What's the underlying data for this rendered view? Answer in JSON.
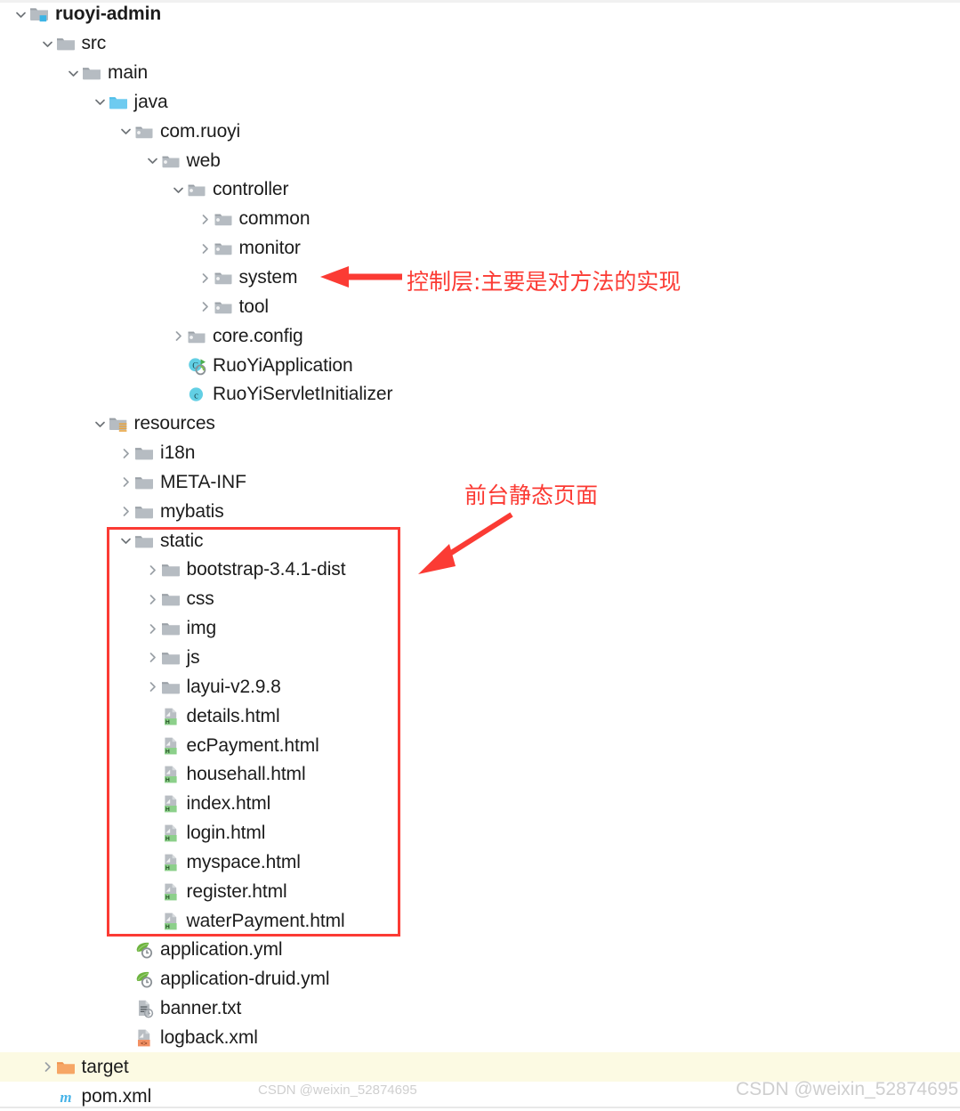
{
  "window": {
    "kind": "ide-project-tree"
  },
  "tree": {
    "rows": [
      {
        "label": "ruoyi-admin",
        "depth": 0,
        "twisty": "expanded",
        "icon": "module-folder-icon",
        "bold": true,
        "highlight": false
      },
      {
        "label": "src",
        "depth": 1,
        "twisty": "expanded",
        "icon": "folder-icon",
        "bold": false,
        "highlight": false
      },
      {
        "label": "main",
        "depth": 2,
        "twisty": "expanded",
        "icon": "folder-icon",
        "bold": false,
        "highlight": false
      },
      {
        "label": "java",
        "depth": 3,
        "twisty": "expanded",
        "icon": "source-root-folder-icon",
        "bold": false,
        "highlight": false
      },
      {
        "label": "com.ruoyi",
        "depth": 4,
        "twisty": "expanded",
        "icon": "package-icon",
        "bold": false,
        "highlight": false
      },
      {
        "label": "web",
        "depth": 5,
        "twisty": "expanded",
        "icon": "package-icon",
        "bold": false,
        "highlight": false
      },
      {
        "label": "controller",
        "depth": 6,
        "twisty": "expanded",
        "icon": "package-icon",
        "bold": false,
        "highlight": false
      },
      {
        "label": "common",
        "depth": 7,
        "twisty": "collapsed",
        "icon": "package-icon",
        "bold": false,
        "highlight": false
      },
      {
        "label": "monitor",
        "depth": 7,
        "twisty": "collapsed",
        "icon": "package-icon",
        "bold": false,
        "highlight": false
      },
      {
        "label": "system",
        "depth": 7,
        "twisty": "collapsed",
        "icon": "package-icon",
        "bold": false,
        "highlight": false
      },
      {
        "label": "tool",
        "depth": 7,
        "twisty": "collapsed",
        "icon": "package-icon",
        "bold": false,
        "highlight": false
      },
      {
        "label": "core.config",
        "depth": 6,
        "twisty": "collapsed",
        "icon": "package-icon",
        "bold": false,
        "highlight": false
      },
      {
        "label": "RuoYiApplication",
        "depth": 6,
        "twisty": "none",
        "icon": "spring-boot-class-icon",
        "bold": false,
        "highlight": false
      },
      {
        "label": "RuoYiServletInitializer",
        "depth": 6,
        "twisty": "none",
        "icon": "java-class-icon",
        "bold": false,
        "highlight": false
      },
      {
        "label": "resources",
        "depth": 3,
        "twisty": "expanded",
        "icon": "resources-root-folder-icon",
        "bold": false,
        "highlight": false
      },
      {
        "label": "i18n",
        "depth": 4,
        "twisty": "collapsed",
        "icon": "folder-icon",
        "bold": false,
        "highlight": false
      },
      {
        "label": "META-INF",
        "depth": 4,
        "twisty": "collapsed",
        "icon": "folder-icon",
        "bold": false,
        "highlight": false
      },
      {
        "label": "mybatis",
        "depth": 4,
        "twisty": "collapsed",
        "icon": "folder-icon",
        "bold": false,
        "highlight": false
      },
      {
        "label": "static",
        "depth": 4,
        "twisty": "expanded",
        "icon": "folder-icon",
        "bold": false,
        "highlight": false
      },
      {
        "label": "bootstrap-3.4.1-dist",
        "depth": 5,
        "twisty": "collapsed",
        "icon": "folder-icon",
        "bold": false,
        "highlight": false
      },
      {
        "label": "css",
        "depth": 5,
        "twisty": "collapsed",
        "icon": "folder-icon",
        "bold": false,
        "highlight": false
      },
      {
        "label": "img",
        "depth": 5,
        "twisty": "collapsed",
        "icon": "folder-icon",
        "bold": false,
        "highlight": false
      },
      {
        "label": "js",
        "depth": 5,
        "twisty": "collapsed",
        "icon": "folder-icon",
        "bold": false,
        "highlight": false
      },
      {
        "label": "layui-v2.9.8",
        "depth": 5,
        "twisty": "collapsed",
        "icon": "folder-icon",
        "bold": false,
        "highlight": false
      },
      {
        "label": "details.html",
        "depth": 5,
        "twisty": "none",
        "icon": "html-file-icon",
        "bold": false,
        "highlight": false
      },
      {
        "label": "ecPayment.html",
        "depth": 5,
        "twisty": "none",
        "icon": "html-file-icon",
        "bold": false,
        "highlight": false
      },
      {
        "label": "househall.html",
        "depth": 5,
        "twisty": "none",
        "icon": "html-file-icon",
        "bold": false,
        "highlight": false
      },
      {
        "label": "index.html",
        "depth": 5,
        "twisty": "none",
        "icon": "html-file-icon",
        "bold": false,
        "highlight": false
      },
      {
        "label": "login.html",
        "depth": 5,
        "twisty": "none",
        "icon": "html-file-icon",
        "bold": false,
        "highlight": false
      },
      {
        "label": "myspace.html",
        "depth": 5,
        "twisty": "none",
        "icon": "html-file-icon",
        "bold": false,
        "highlight": false
      },
      {
        "label": "register.html",
        "depth": 5,
        "twisty": "none",
        "icon": "html-file-icon",
        "bold": false,
        "highlight": false
      },
      {
        "label": "waterPayment.html",
        "depth": 5,
        "twisty": "none",
        "icon": "html-file-icon",
        "bold": false,
        "highlight": false
      },
      {
        "label": "application.yml",
        "depth": 4,
        "twisty": "none",
        "icon": "spring-yaml-file-icon",
        "bold": false,
        "highlight": false
      },
      {
        "label": "application-druid.yml",
        "depth": 4,
        "twisty": "none",
        "icon": "spring-yaml-file-icon",
        "bold": false,
        "highlight": false
      },
      {
        "label": "banner.txt",
        "depth": 4,
        "twisty": "none",
        "icon": "text-file-icon",
        "bold": false,
        "highlight": false
      },
      {
        "label": "logback.xml",
        "depth": 4,
        "twisty": "none",
        "icon": "xml-file-icon",
        "bold": false,
        "highlight": false
      },
      {
        "label": "target",
        "depth": 1,
        "twisty": "collapsed",
        "icon": "excluded-folder-icon",
        "bold": false,
        "highlight": true
      },
      {
        "label": "pom.xml",
        "depth": 1,
        "twisty": "none",
        "icon": "maven-pom-icon",
        "bold": false,
        "highlight": false
      }
    ]
  },
  "annotations": {
    "color": "#fb3b34",
    "items": [
      {
        "text": "控制层:主要是对方法的实现",
        "name": "annotation-controller-layer"
      },
      {
        "text": "前台静态页面",
        "name": "annotation-frontend-static-pages"
      }
    ]
  },
  "watermarks": {
    "inline": "CSDN @weixin_52874695",
    "corner": "CSDN @weixin_52874695"
  }
}
